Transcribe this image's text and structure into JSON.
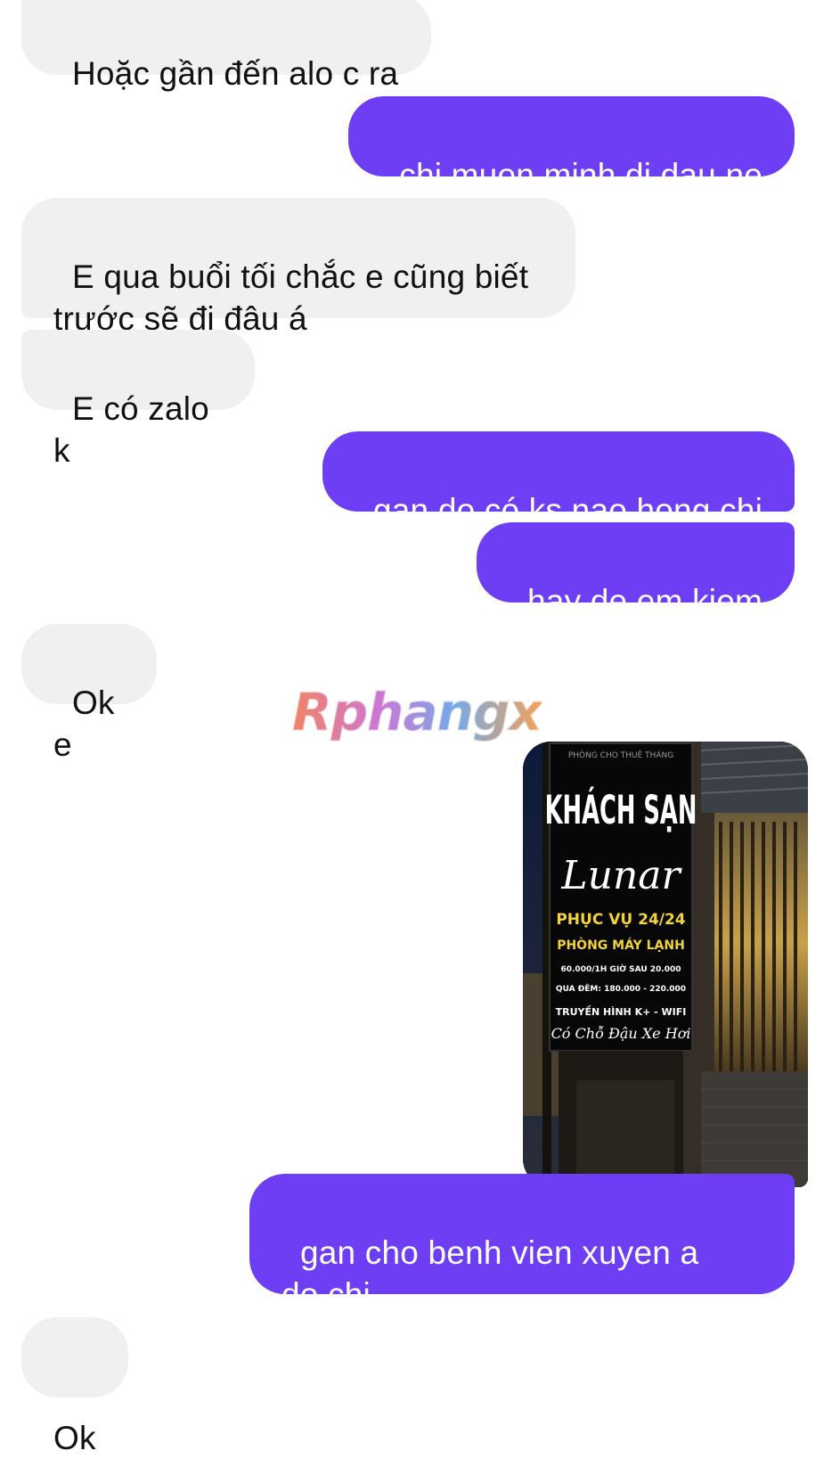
{
  "conversation": {
    "messages": [
      {
        "id": "m1",
        "side": "in",
        "text": "Hoặc gần đến alo c ra"
      },
      {
        "id": "m2",
        "side": "out",
        "text": "chi muon minh di dau ne"
      },
      {
        "id": "m3",
        "side": "in",
        "text": "E qua buổi tối chắc e cũng biết\ntrước sẽ đi đâu á"
      },
      {
        "id": "m4",
        "side": "in",
        "text": "E có zalo k"
      },
      {
        "id": "m5",
        "side": "out",
        "text": "gan do có ks nao hong chi"
      },
      {
        "id": "m6",
        "side": "out",
        "text": "hay de em kiem"
      },
      {
        "id": "m7",
        "side": "in",
        "text": "Ok e"
      },
      {
        "id": "m8",
        "side": "out",
        "text": "gan cho benh vien xuyen a\ndo chi"
      },
      {
        "id": "m9",
        "side": "in",
        "text": "Ok"
      }
    ],
    "photo": {
      "sign": {
        "top_strip": "PHÒNG CHO THUÊ THÁNG",
        "title": "KHÁCH SẠN",
        "name": "Lunar",
        "service": "PHỤC VỤ 24/24",
        "ac_rooms": "PHÒNG MÁY LẠNH",
        "price_hourly": "60.000/1H GIỜ SAU 20.000",
        "price_night": "QUA ĐÊM: 180.000 - 220.000",
        "amenities": "TRUYỀN HÌNH K+ - WIFI",
        "parking": "Có Chỗ Đậu Xe Hơi"
      }
    }
  },
  "watermark": "Rphangx",
  "colors": {
    "outgoing_bubble": "#6e3ef5",
    "incoming_bubble": "#f0f0f0",
    "sign_yellow": "#f2d338"
  }
}
